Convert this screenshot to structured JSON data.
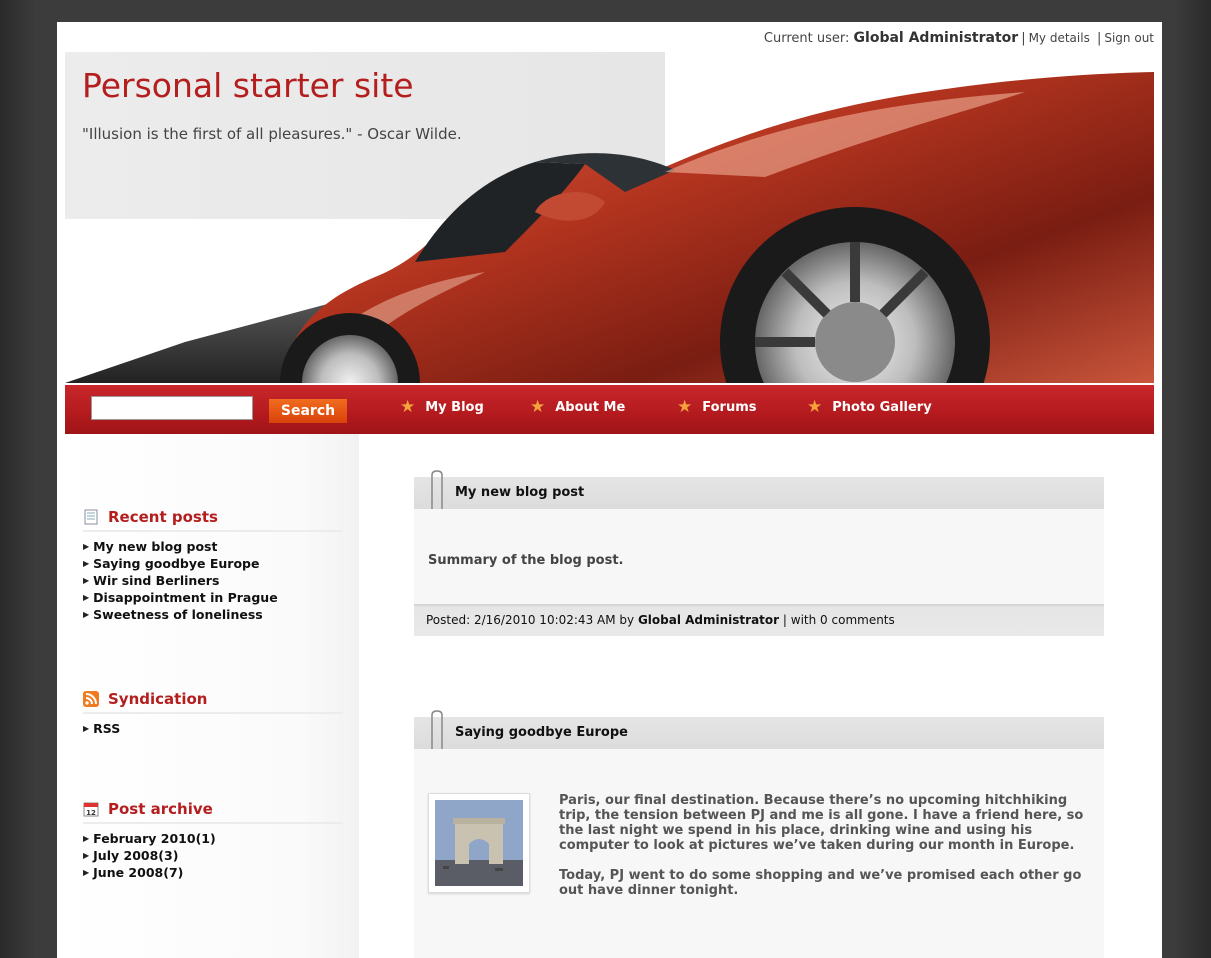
{
  "user_bar": {
    "label": "Current user:",
    "username": "Global Administrator",
    "my_details": "My details",
    "sign_out": "Sign out"
  },
  "header": {
    "site_title": "Personal starter site",
    "motto": "\"Illusion is the first of all pleasures.\" - Oscar Wilde."
  },
  "nav": {
    "search_value": "",
    "search_button": "Search",
    "items": [
      {
        "label": "My Blog"
      },
      {
        "label": "About Me"
      },
      {
        "label": "Forums"
      },
      {
        "label": "Photo Gallery"
      }
    ]
  },
  "sidebar": {
    "recent_posts": {
      "title": "Recent posts",
      "items": [
        "My new blog post",
        "Saying goodbye Europe",
        "Wir sind Berliners",
        "Disappointment in Prague",
        "Sweetness of loneliness"
      ]
    },
    "syndication": {
      "title": "Syndication",
      "items": [
        "RSS"
      ]
    },
    "archive": {
      "title": "Post archive",
      "items": [
        "February 2010(1)",
        "July 2008(3)",
        "June 2008(7)"
      ]
    }
  },
  "posts": [
    {
      "title": "My new blog post",
      "summary": "Summary of the blog post.",
      "footer_posted": "Posted: 2/16/2010 10:02:43 AM by",
      "footer_author": "Global Administrator",
      "footer_comments": "| with 0 comments"
    },
    {
      "title": "Saying goodbye Europe",
      "paragraph1": "Paris, our final destination. Because there’s no upcoming hitchhiking trip, the tension between PJ and me is all gone. I have a friend here, so the last night we spend in his place, drinking wine and using his computer to look at pictures we’ve taken during our month in Europe.",
      "paragraph2": "Today, PJ went to do some shopping and we’ve promised each other go out have dinner tonight."
    }
  ],
  "colors": {
    "brand_red": "#b41e1e",
    "nav_red": "#c0232a",
    "search_orange": "#e8561a",
    "star_orange": "#f4a23c"
  }
}
